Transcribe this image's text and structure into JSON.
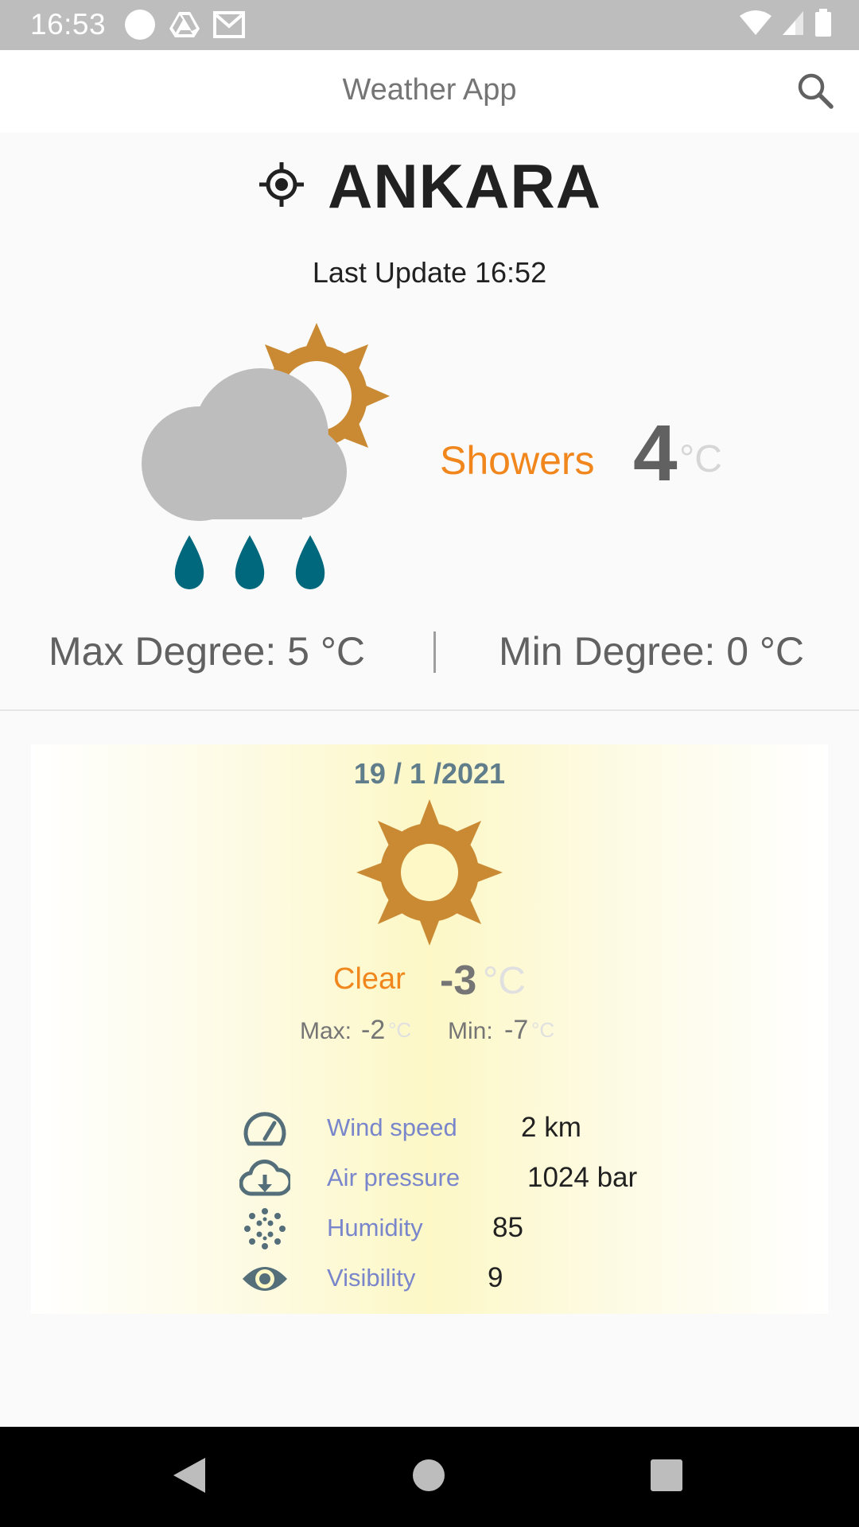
{
  "status_bar": {
    "time": "16:53"
  },
  "app_bar": {
    "title": "Weather App",
    "search_icon": "search-icon"
  },
  "location": {
    "city": "ANKARA",
    "icon": "my-location-icon",
    "last_update": "Last Update 16:52"
  },
  "current": {
    "icon": "cloud-sun-rain-icon",
    "description": "Showers",
    "temperature": "4",
    "unit": "°C",
    "max_degree": "Max Degree: 5 °C",
    "min_degree": "Min Degree: 0 °C"
  },
  "forecast": {
    "date": "19 / 1 /2021",
    "icon": "sun-icon",
    "description": "Clear",
    "temperature": "-3",
    "unit": "°C",
    "max_label": "Max:",
    "max_value": "-2",
    "min_label": "Min:",
    "min_value": "-7",
    "small_unit": "°C",
    "details": [
      {
        "icon": "speedometer-icon",
        "label": "Wind speed",
        "value": "2 km"
      },
      {
        "icon": "cloud-download-icon",
        "label": "Air pressure",
        "value": "1024 bar"
      },
      {
        "icon": "humidity-dots-icon",
        "label": "Humidity",
        "value": "85"
      },
      {
        "icon": "eye-icon",
        "label": "Visibility",
        "value": "9"
      }
    ]
  },
  "colors": {
    "accent_orange": "#f0861c",
    "sun": "#c98a33",
    "rain": "#00687d",
    "label_blue": "#7986cb",
    "date_gray": "#607d8b"
  }
}
